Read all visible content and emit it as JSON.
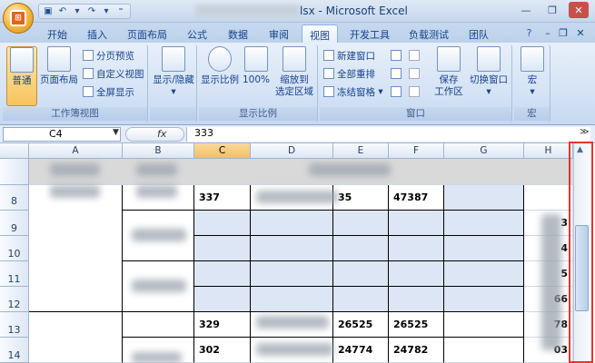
{
  "titlebar": {
    "title": "lsx - Microsoft Excel",
    "qat_icons": [
      "save-icon",
      "undo-icon",
      "redo-icon",
      "customize-icon"
    ]
  },
  "tabs": [
    "开始",
    "插入",
    "页面布局",
    "公式",
    "数据",
    "审阅",
    "视图",
    "开发工具",
    "负载测试",
    "团队"
  ],
  "active_tab": "视图",
  "ribbon": {
    "groups": {
      "workbook_views": "工作簿视图",
      "show_hide": "",
      "zoom": "显示比例",
      "window": "窗口",
      "macros": "宏"
    },
    "buttons": {
      "normal": "普通",
      "page_layout": "页面布局",
      "page_break": "分页预览",
      "custom_view": "自定义视图",
      "full_screen": "全屏显示",
      "show_hide": "显示/隐藏",
      "zoom": "显示比例",
      "zoom100": "100%",
      "zoom_selection": "缩放到\n选定区域",
      "new_window": "新建窗口",
      "arrange_all": "全部重排",
      "freeze_panes": "冻结窗格",
      "save_workspace": "保存\n工作区",
      "switch_window": "切换窗口",
      "macros": "宏"
    }
  },
  "formula_bar": {
    "name_box": "C4",
    "fx": "fx",
    "value": "333"
  },
  "grid": {
    "columns": [
      "A",
      "B",
      "C",
      "D",
      "E",
      "F",
      "G",
      "H"
    ],
    "selected_column": "C",
    "rows": [
      "8",
      "9",
      "10",
      "11",
      "12",
      "13",
      "14"
    ],
    "cells": {
      "c8": "337",
      "e8": "35",
      "f8": "47387",
      "h9": "3",
      "h10": "4",
      "h11": "5",
      "h12": "66",
      "c13": "329",
      "e13": "26525",
      "f13": "26525",
      "h13": "78",
      "c14": "302",
      "e14": "24774",
      "f14": "24782",
      "h14": "03"
    }
  }
}
